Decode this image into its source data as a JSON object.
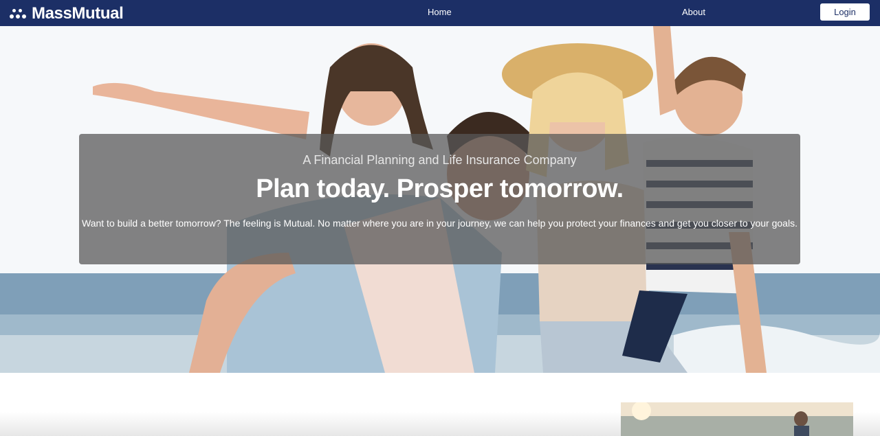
{
  "brand": {
    "name": "MassMutual",
    "color": "#1c2f66"
  },
  "nav": {
    "home_label": "Home",
    "about_label": "About",
    "login_label": "Login"
  },
  "hero": {
    "eyebrow": "A Financial Planning and Life Insurance Company",
    "title": "Plan today. Prosper tomorrow.",
    "body": "Want to build a better tomorrow? The feeling is Mutual. No matter where you are in your journey, we can help you protect your finances and get you closer to your goals.",
    "image_subject": "smiling-family-at-beach-photo"
  },
  "colors": {
    "navbar": "#1c2f66",
    "overlay": "#585858",
    "button_bg": "#ffffff"
  }
}
